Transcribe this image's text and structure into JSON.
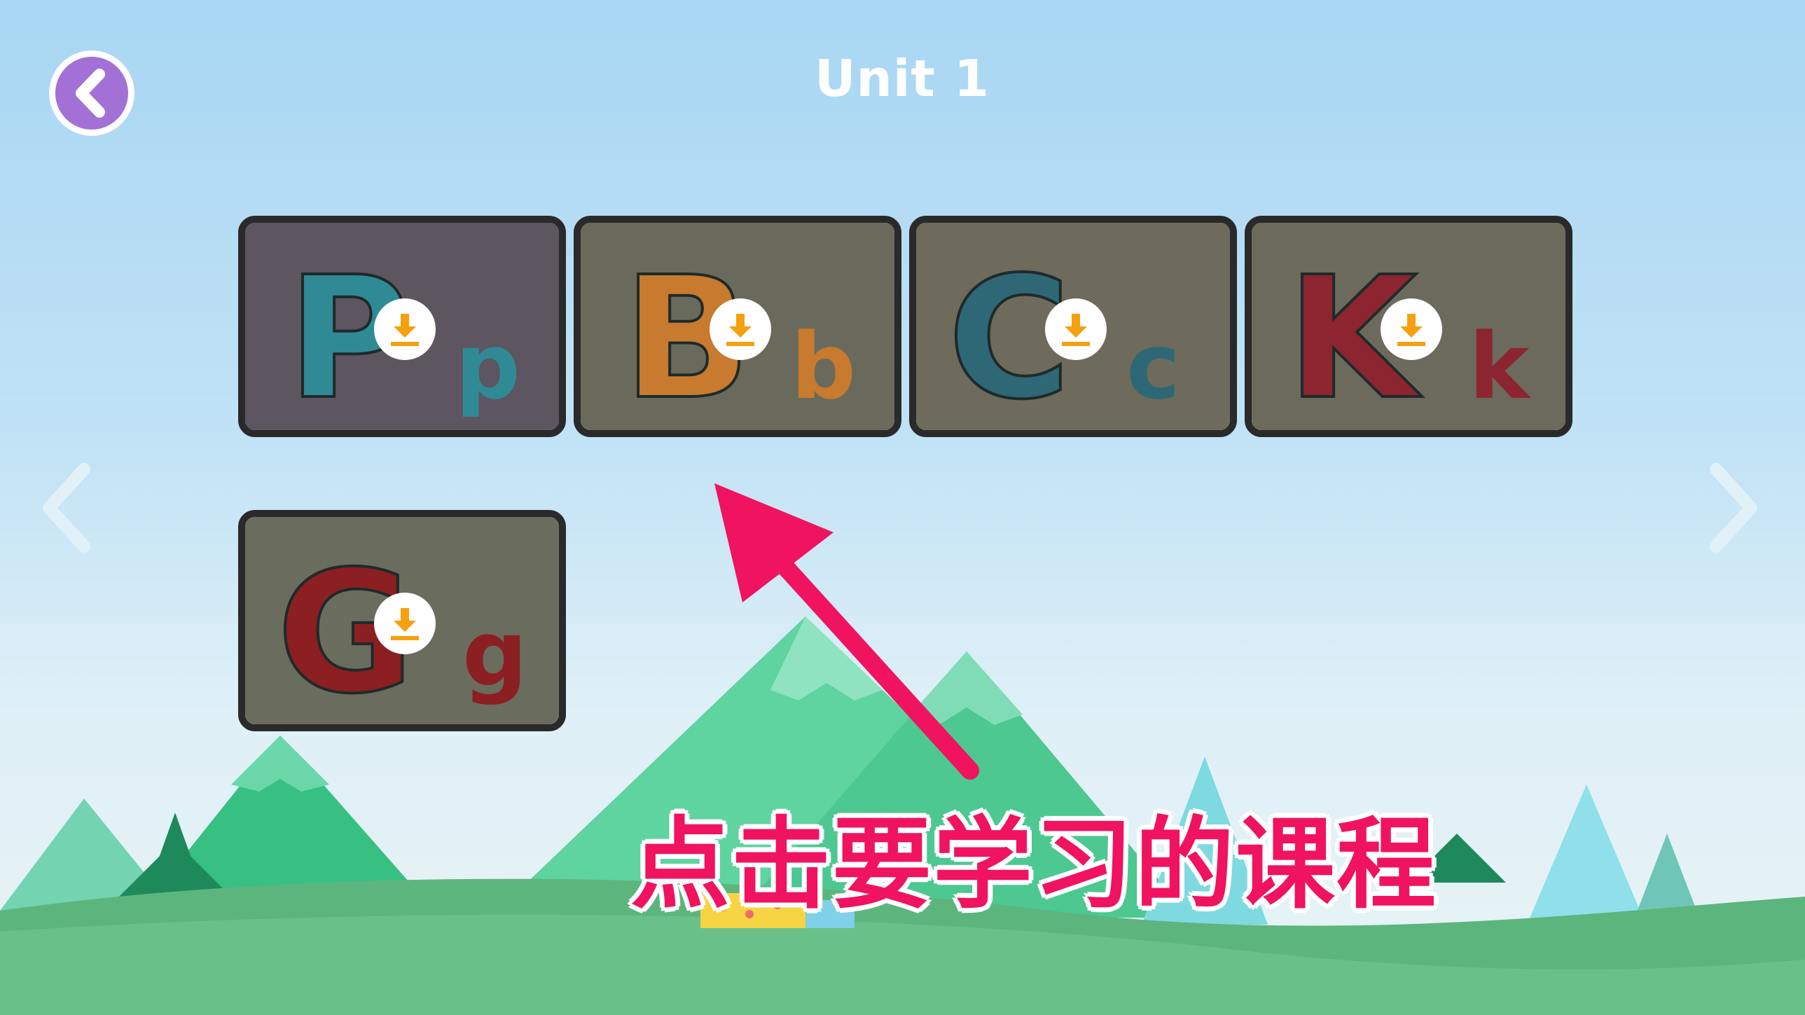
{
  "header": {
    "title": "Unit 1"
  },
  "navigation": {
    "back_icon": "chevron-left-icon",
    "prev_icon": "chevron-left-icon",
    "next_icon": "chevron-right-icon"
  },
  "lessons": [
    {
      "upper": "P",
      "lower": "p",
      "upper_color": "#2f8a96",
      "lower_color": "#2f8a96",
      "bg": "#5d5560",
      "status_icon": "download-icon"
    },
    {
      "upper": "B",
      "lower": "b",
      "upper_color": "#c87a2e",
      "lower_color": "#c87a2e",
      "bg": "#6a6a5c",
      "status_icon": "download-icon"
    },
    {
      "upper": "C",
      "lower": "c",
      "upper_color": "#2e6877",
      "lower_color": "#2e6877",
      "bg": "#6e6a5c",
      "status_icon": "download-icon"
    },
    {
      "upper": "K",
      "lower": "k",
      "upper_color": "#8c2530",
      "lower_color": "#8c2530",
      "bg": "#6c6a5c",
      "status_icon": "download-icon"
    },
    {
      "upper": "G",
      "lower": "g",
      "upper_color": "#8c1f22",
      "lower_color": "#8c1f22",
      "bg": "#6a6c5e",
      "status_icon": "download-icon"
    }
  ],
  "annotation": {
    "text": "点击要学习的课程",
    "color": "#f0135f"
  },
  "colors": {
    "accent": "#a371d6",
    "download": "#f5a00f"
  }
}
